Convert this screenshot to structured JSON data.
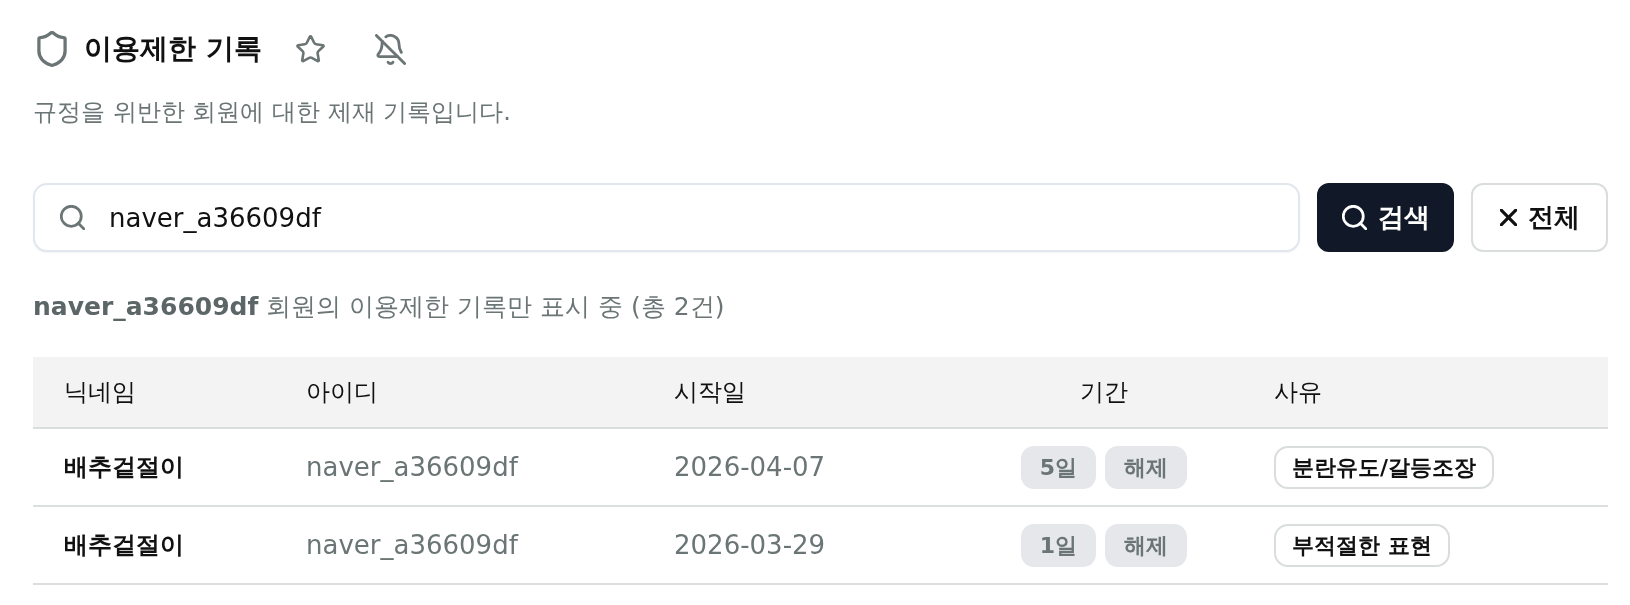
{
  "header": {
    "title": "이용제한 기록",
    "description": "규정을 위반한 회원에 대한 제재 기록입니다."
  },
  "search": {
    "value": "naver_a36609df",
    "buttons": [
      {
        "kind": "primary",
        "label": "검색"
      },
      {
        "kind": "secondary",
        "label": "전체"
      }
    ]
  },
  "filter_note": "**naver_a36609df** 회원의 이용제한 기록만 표시 중 (총 2건)",
  "table": {
    "columns": [
      "닉네임",
      "아이디",
      "시작일",
      "기간",
      "사유"
    ],
    "rows": [
      {
        "nickname": "배추겉절이",
        "user_id": "naver_a36609df",
        "start_date": "2026-04-07",
        "duration": "5일",
        "action": "해제",
        "reason": "분란유도/갈등조장"
      },
      {
        "nickname": "배추겉절이",
        "user_id": "naver_a36609df",
        "start_date": "2026-03-29",
        "duration": "1일",
        "action": "해제",
        "reason": "부적절한 표현"
      }
    ]
  }
}
